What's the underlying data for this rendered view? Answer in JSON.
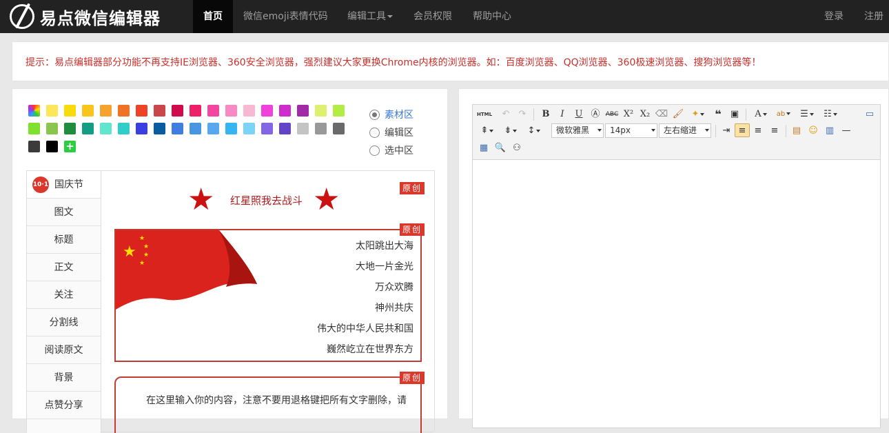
{
  "nav": {
    "brand": "易点微信编辑器",
    "items": [
      {
        "label": "首页",
        "active": true
      },
      {
        "label": "微信emoji表情代码"
      },
      {
        "label": "编辑工具"
      },
      {
        "label": "会员权限"
      },
      {
        "label": "帮助中心"
      }
    ],
    "login": "登录",
    "register": "注册"
  },
  "notice": "提示：易点编辑器部分功能不再支持IE浏览器、360安全浏览器，强烈建议大家更换Chrome内核的浏览器。如：百度浏览器、QQ浏览器、360极速浏览器、搜狗浏览器等！",
  "palette": {
    "colors": [
      "#f8d21f",
      "#fce75a",
      "#f9da0b",
      "#f9c51c",
      "#f5a32d",
      "#f07325",
      "#ee4327",
      "#c9464a",
      "#cf0b4d",
      "#ee1f6a",
      "#f2479f",
      "#f78ac3",
      "#f9b8d2",
      "#f041db",
      "#cd2ecb",
      "#a32aa7",
      "#dff06f",
      "#b3ec44",
      "#7ee12b",
      "#8ac54e",
      "#1e8e3d",
      "#139e83",
      "#60e6cf",
      "#31cdca",
      "#3b3ee0",
      "#095ca0",
      "#3f7ee0",
      "#4796e2",
      "#58a8f0",
      "#35b6f2",
      "#7bd3f6",
      "#8465e6",
      "#6444c6",
      "#c4c4c4",
      "#999999",
      "#6a6a6a",
      "#3b3b3b",
      "#000000"
    ],
    "add_label": "+"
  },
  "modes": [
    {
      "label": "素材区",
      "checked": true
    },
    {
      "label": "编辑区",
      "checked": false
    },
    {
      "label": "选中区",
      "checked": false
    }
  ],
  "categories": {
    "first_icon_text": "10·1",
    "items": [
      "国庆节",
      "图文",
      "标题",
      "正文",
      "关注",
      "分割线",
      "阅读原文",
      "背景",
      "点赞分享"
    ]
  },
  "templates": {
    "badge": "原创",
    "t1_title": "红星照我去战斗",
    "poem": [
      "太阳跳出大海",
      "大地一片金光",
      "万众欢腾",
      "神州共庆",
      "伟大的中华人民共和国",
      "巍然屹立在世界东方"
    ],
    "t3_text": "在这里输入你的内容，注意不要用退格键把所有文字删除，请"
  },
  "editor": {
    "html_label": "HTML",
    "font_family": "微软雅黑",
    "font_size": "14px",
    "indent": "左右缩进"
  }
}
